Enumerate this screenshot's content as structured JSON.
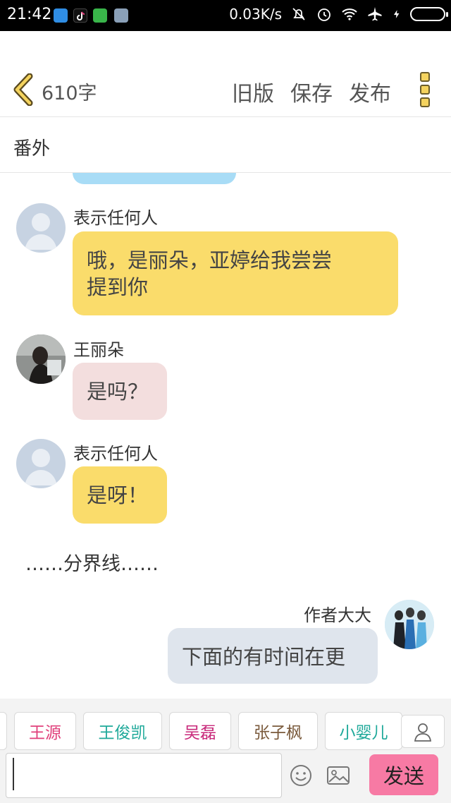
{
  "status_bar": {
    "time": "21:42",
    "network_speed": "0.03K/s",
    "icons": [
      "notification-app-icon",
      "tiktok-icon",
      "wechat-icon",
      "notes-icon",
      "mute-icon",
      "alarm-icon",
      "wifi-icon",
      "airplane-icon",
      "charging-icon",
      "battery-icon"
    ]
  },
  "header": {
    "word_count": "610字",
    "old_version_label": "旧版",
    "save_label": "保存",
    "publish_label": "发布"
  },
  "title": "番外",
  "messages": [
    {
      "side": "left",
      "name": "表示任何人",
      "text_lines": [
        "哦，是丽朵，亚婷给我尝尝",
        "提到你"
      ],
      "bubble_color": "#fadc6b",
      "avatar": "default"
    },
    {
      "side": "left",
      "name": "王丽朵",
      "text": "是吗？",
      "bubble_color": "#f3dede",
      "avatar": "photo"
    },
    {
      "side": "left",
      "name": "表示任何人",
      "text": "是呀！",
      "bubble_color": "#fadc6b",
      "avatar": "default"
    },
    {
      "side": "right",
      "name": "作者大大",
      "text": "下面的有时间在更",
      "bubble_color": "#dfe5ed",
      "avatar": "photo"
    }
  ],
  "divider": "……分界线……",
  "characters": [
    {
      "label": "王源",
      "color": "#e0407b"
    },
    {
      "label": "王俊凯",
      "color": "#1fa99a"
    },
    {
      "label": "吴磊",
      "color": "#c8287a"
    },
    {
      "label": "张子枫",
      "color": "#7a5a3c"
    },
    {
      "label": "小婴儿",
      "color": "#1fa99a"
    }
  ],
  "input": {
    "value": "",
    "send_label": "发送"
  },
  "colors": {
    "accent_yellow": "#f4d35e",
    "send_pink": "#f77aa4"
  }
}
